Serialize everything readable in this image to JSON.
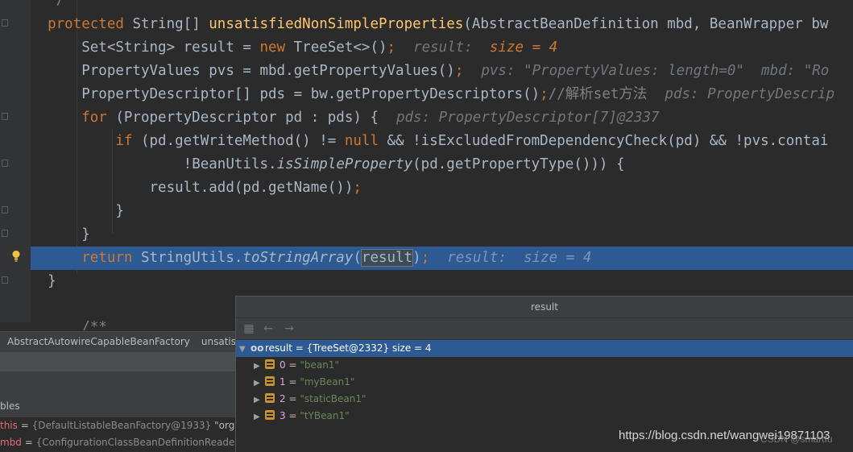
{
  "editor": {
    "line0": {
      "prefix": "*/"
    },
    "line1": {
      "kw": "protected",
      "t1": " String[] ",
      "fn": "unsatisfiedNonSimpleProperties",
      "t2": "(AbstractBeanDefinition mbd, BeanWrapper bw"
    },
    "line2": {
      "t1": "Set<String> result = ",
      "kw": "new",
      "t2": " TreeSet<>()",
      "semi": ";",
      "hint": "result:",
      "hint_val": "  size = 4"
    },
    "line3": {
      "t1": "PropertyValues pvs = mbd.getPropertyValues()",
      "semi": ";",
      "hint": "pvs: \"PropertyValues: length=0\"  mbd: \"Ro"
    },
    "line4": {
      "t1": "PropertyDescriptor[] pds = bw.getPropertyDescriptors()",
      "semi": ";",
      "comment": "//解析set方法",
      "hint": "pds: PropertyDescrip"
    },
    "line5": {
      "kw": "for",
      "t1": " (PropertyDescriptor pd : pds) {",
      "hint": "pds: PropertyDescriptor[7]@2337"
    },
    "line6": {
      "kw": "if",
      "t1": " (pd.getWriteMethod() != ",
      "kw2": "null",
      "t2": " && !isExcludedFromDependencyCheck(pd) && !pvs.contai"
    },
    "line7": {
      "t1": "!BeanUtils.",
      "it": "isSimpleProperty",
      "t2": "(pd.getPropertyType())) {"
    },
    "line8": {
      "t1": "result.add(pd.getName())",
      "semi": ";"
    },
    "line9": {
      "t1": "}"
    },
    "line10": {
      "t1": "}"
    },
    "line11": {
      "kw": "return",
      "t1": " StringUtils.",
      "it": "toStringArray",
      "t2": "(",
      "boxed": "result",
      "t3": ")",
      "semi": ";",
      "hint": "result:",
      "hint_val": "  size = 4"
    },
    "line12": {
      "t1": "}"
    },
    "line13": {
      "t1": "/**"
    }
  },
  "breadcrumb": {
    "item1": "AbstractAutowireCapableBeanFactory",
    "item2": "unsatisf"
  },
  "variables": {
    "tab_label": "bles",
    "rows": [
      {
        "name": "this",
        "eq": " = ",
        "value": "{DefaultListableBeanFactory@1933} ",
        "str": "\"org.spr"
      },
      {
        "name": "mbd",
        "eq": " = ",
        "value": "{ConfigurationClassBeanDefinitionReader$C",
        "str": ""
      }
    ]
  },
  "popup": {
    "title": "result",
    "root": {
      "name": "result",
      "value": " = {TreeSet@2332}  size = 4"
    },
    "items": [
      {
        "index": "0",
        "value": "\"bean1\""
      },
      {
        "index": "1",
        "value": "\"myBean1\""
      },
      {
        "index": "2",
        "value": "\"staticBean1\""
      },
      {
        "index": "3",
        "value": "\"tYBean1\""
      }
    ]
  },
  "watermark": {
    "text": "https://blog.csdn.net/wangwei19871103",
    "sub": "CSDN @smartfu"
  },
  "colors": {
    "keyword": "#cc7832",
    "method": "#ffc66d",
    "string": "#6a8759",
    "selection": "#2d5a92"
  },
  "icons": [
    "lightbulb-icon",
    "watch-icon",
    "field-icon",
    "expand-arrow-icon",
    "back-arrow-icon",
    "forward-arrow-icon",
    "tree-icon"
  ]
}
